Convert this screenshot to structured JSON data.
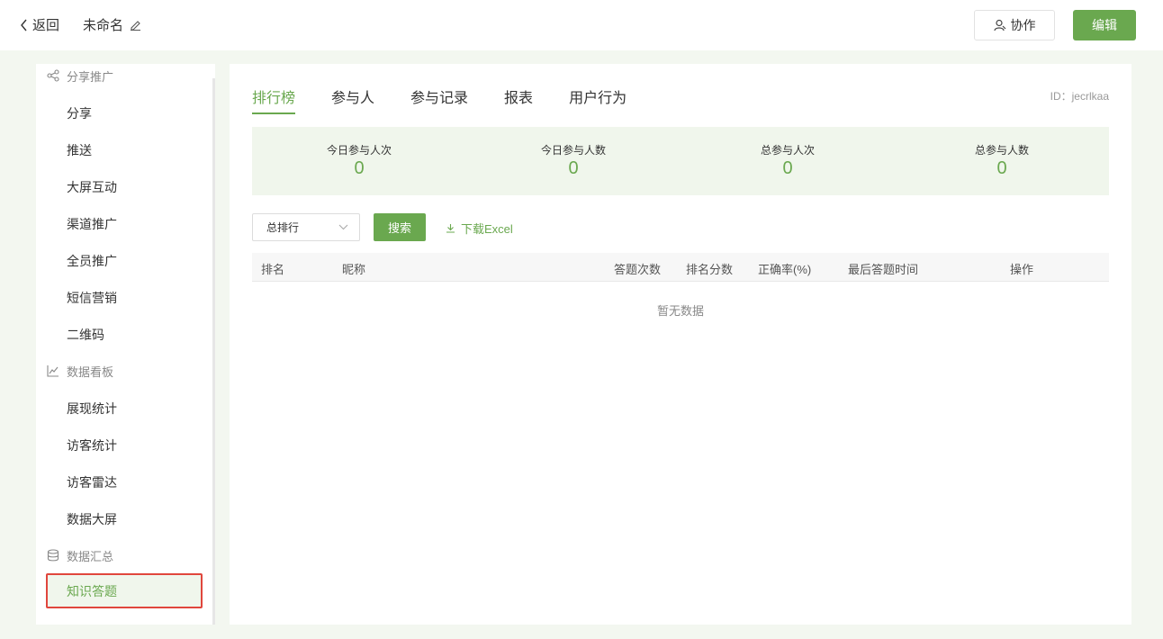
{
  "header": {
    "back_label": "返回",
    "title": "未命名",
    "collab_label": "协作",
    "edit_label": "编辑"
  },
  "sidebar": {
    "groups": [
      {
        "title": "分享推广",
        "icon": "share-icon",
        "items": [
          "分享",
          "推送",
          "大屏互动",
          "渠道推广",
          "全员推广",
          "短信营销",
          "二维码"
        ]
      },
      {
        "title": "数据看板",
        "icon": "line-chart-icon",
        "items": [
          "展现统计",
          "访客统计",
          "访客雷达",
          "数据大屏"
        ]
      },
      {
        "title": "数据汇总",
        "icon": "database-icon",
        "items": [
          "知识答题"
        ]
      }
    ]
  },
  "main": {
    "tabs": [
      "排行榜",
      "参与人",
      "参与记录",
      "报表",
      "用户行为"
    ],
    "active_tab": "排行榜",
    "id_label": "ID：jecrlkaa",
    "stats": [
      {
        "label": "今日参与人次",
        "value": "0"
      },
      {
        "label": "今日参与人数",
        "value": "0"
      },
      {
        "label": "总参与人次",
        "value": "0"
      },
      {
        "label": "总参与人数",
        "value": "0"
      }
    ],
    "filter": {
      "select_value": "总排行",
      "search_label": "搜索",
      "download_label": "下载Excel"
    },
    "table": {
      "columns": [
        "排名",
        "昵称",
        "答题次数",
        "排名分数",
        "正确率(%)",
        "最后答题时间",
        "操作"
      ],
      "empty_text": "暂无数据"
    }
  },
  "colors": {
    "accent": "#6aa84f",
    "highlight_border": "#e0463d",
    "page_bg": "#f3f7f0"
  }
}
